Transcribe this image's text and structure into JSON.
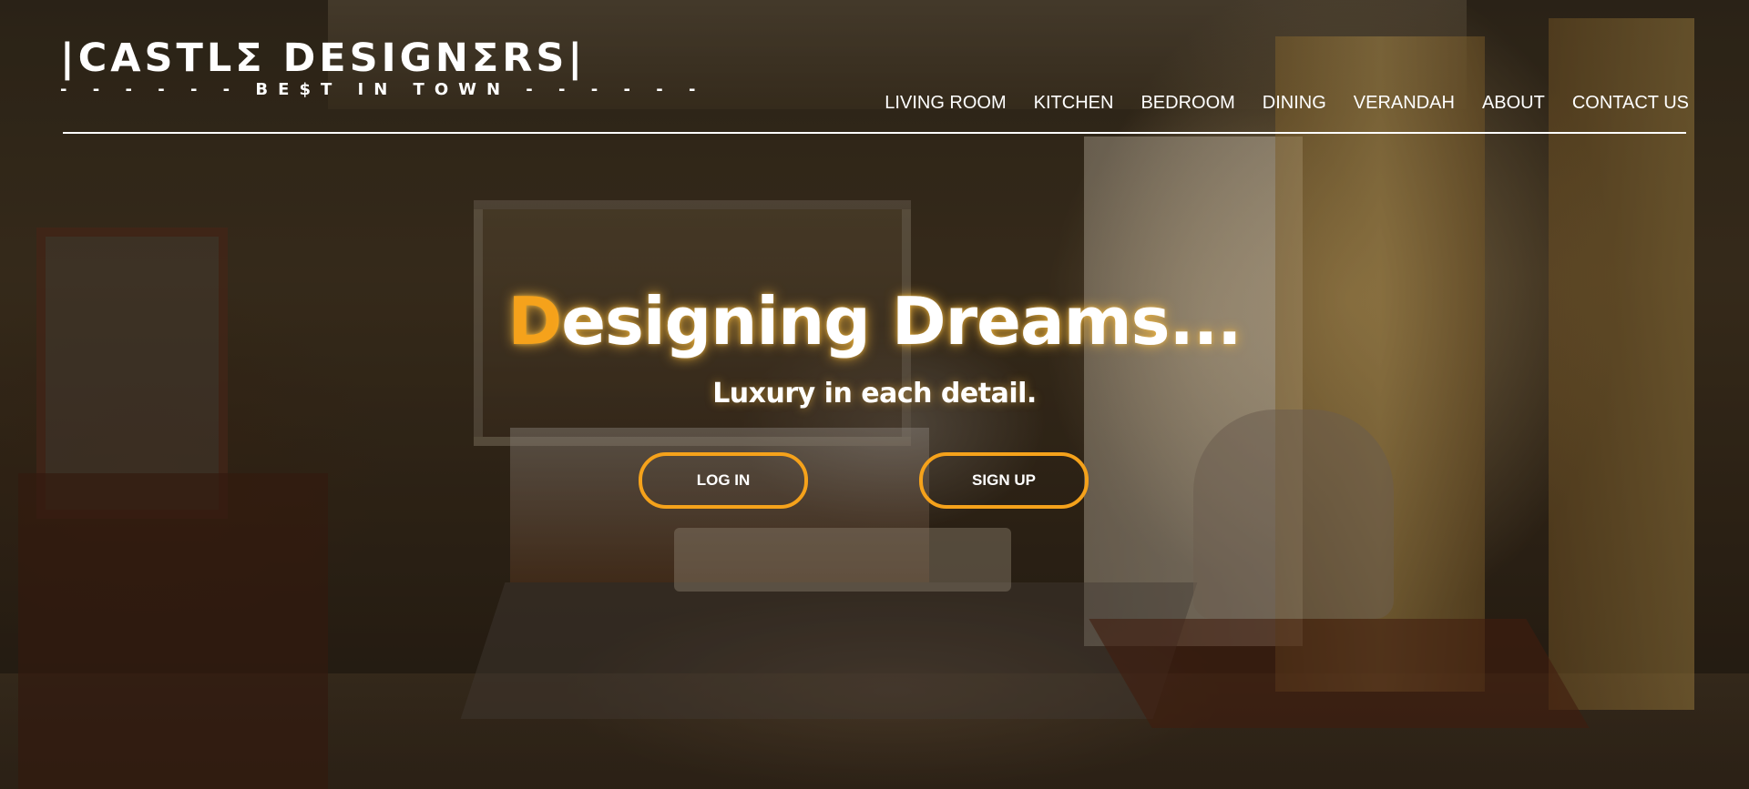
{
  "brand": {
    "name": "|CASTLΣ DESIGNΣRS|",
    "tagline": "- - - - - - BE$T  IN  TOWN - - - - - -"
  },
  "nav": {
    "items": [
      {
        "label": "LIVING ROOM"
      },
      {
        "label": "KITCHEN"
      },
      {
        "label": "BEDROOM"
      },
      {
        "label": "DINING"
      },
      {
        "label": "VERANDAH"
      },
      {
        "label": "ABOUT"
      },
      {
        "label": "CONTACT US"
      }
    ]
  },
  "hero": {
    "headline_first_letter": "D",
    "headline_rest": "esigning Dreams...",
    "subheadline": "Luxury in each detail.",
    "login_label": "LOG IN",
    "signup_label": "SIGN UP"
  },
  "colors": {
    "accent": "#f5a21b",
    "text": "#ffffff"
  }
}
